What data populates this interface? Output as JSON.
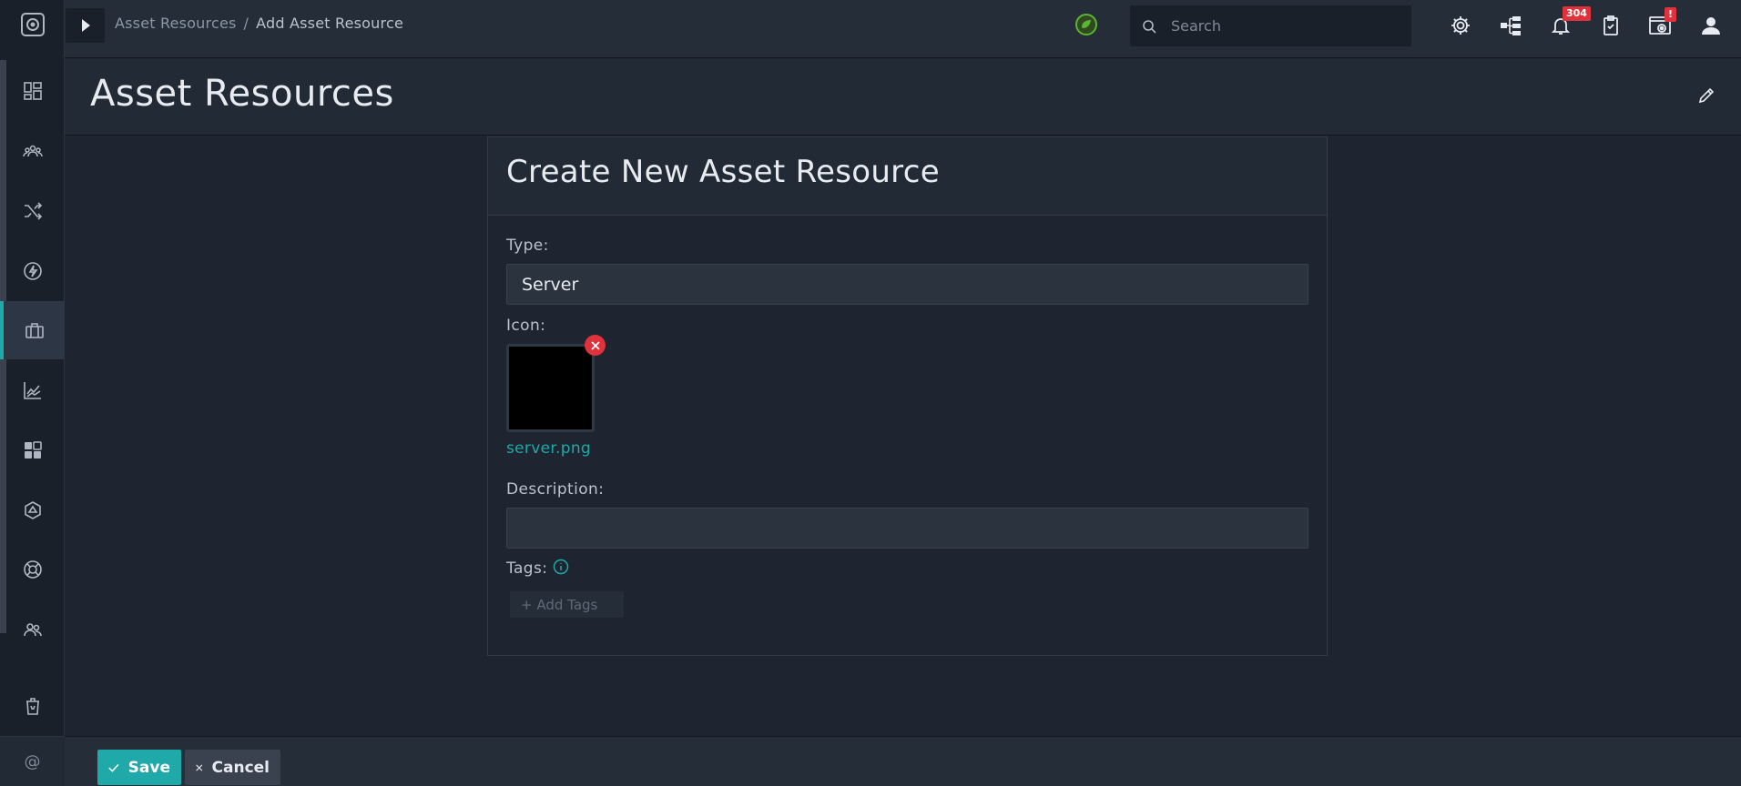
{
  "breadcrumb": {
    "parent": "Asset Resources",
    "separator": "/",
    "current": "Add Asset Resource"
  },
  "search": {
    "placeholder": "Search"
  },
  "notifications": {
    "count": "304"
  },
  "system_alert": {
    "badge": "!"
  },
  "page": {
    "title": "Asset Resources"
  },
  "form": {
    "title": "Create New Asset Resource",
    "type_label": "Type:",
    "type_value": "Server",
    "icon_label": "Icon:",
    "icon_filename": "server.png",
    "description_label": "Description:",
    "description_value": "",
    "tags_label": "Tags:",
    "add_tags_label": "+ Add Tags"
  },
  "footer": {
    "save_label": "Save",
    "cancel_label": "Cancel"
  },
  "sidebar": {
    "at_symbol": "@",
    "items": [
      {
        "icon": "dashboard-icon"
      },
      {
        "icon": "users-group-icon"
      },
      {
        "icon": "shuffle-icon"
      },
      {
        "icon": "lightning-icon"
      },
      {
        "icon": "briefcase-icon",
        "active": true
      },
      {
        "icon": "chart-line-icon"
      },
      {
        "icon": "widgets-icon"
      },
      {
        "icon": "hexagon-icon"
      },
      {
        "icon": "lifebuoy-icon"
      },
      {
        "icon": "team-icon"
      },
      {
        "icon": "trash-icon"
      }
    ]
  },
  "colors": {
    "accent": "#1fa9a9",
    "badge": "#e0323c",
    "status_green": "#5cb531"
  }
}
